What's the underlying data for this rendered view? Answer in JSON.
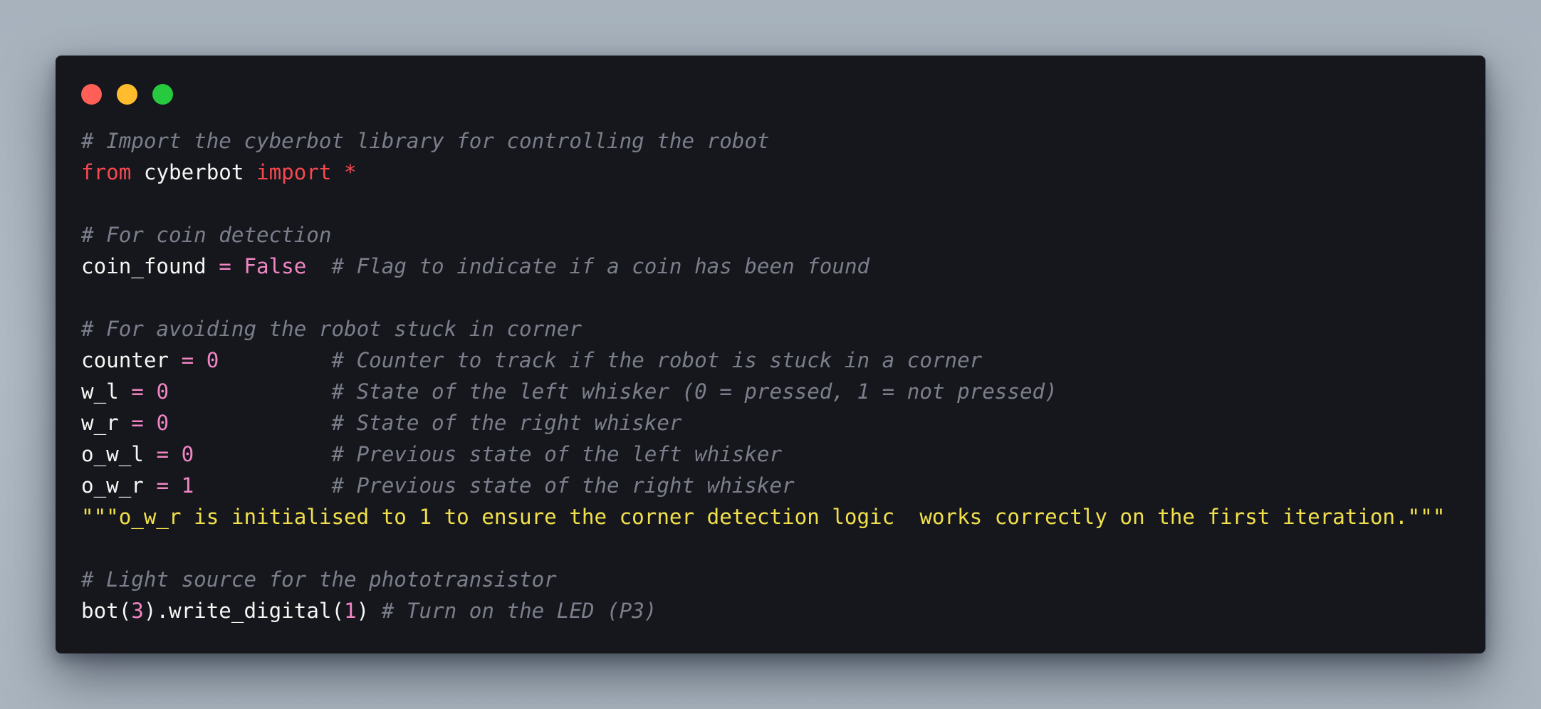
{
  "window": {
    "dots": [
      {
        "name": "close",
        "color": "#ff5f56"
      },
      {
        "name": "minimize",
        "color": "#ffbd2e"
      },
      {
        "name": "maximize",
        "color": "#27c93f"
      }
    ]
  },
  "colors": {
    "background": "#16171d",
    "comment": "#7b7f8b",
    "keyword": "#f5494f",
    "number_operator": "#f286c4",
    "string": "#f1e04b",
    "text": "#f6f6f4"
  },
  "code": {
    "l1": {
      "comment": "# Import the cyberbot library for controlling the robot"
    },
    "l2": {
      "kw1": "from",
      "ident": " cyberbot ",
      "kw2": "import",
      "star": " *"
    },
    "l4": {
      "comment": "# For coin detection"
    },
    "l5": {
      "ident": "coin_found",
      "op": " = ",
      "bool": "False",
      "comment": "  # Flag to indicate if a coin has been found"
    },
    "l7": {
      "comment": "# For avoiding the robot stuck in corner"
    },
    "l8": {
      "ident": "counter",
      "op": " = ",
      "num": "0",
      "pad": "         ",
      "comment": "# Counter to track if the robot is stuck in a corner"
    },
    "l9": {
      "ident": "w_l",
      "op": " = ",
      "num": "0",
      "pad": "             ",
      "comment": "# State of the left whisker (0 = pressed, 1 = not pressed)"
    },
    "l10": {
      "ident": "w_r",
      "op": " = ",
      "num": "0",
      "pad": "             ",
      "comment": "# State of the right whisker"
    },
    "l11": {
      "ident": "o_w_l",
      "op": " = ",
      "num": "0",
      "pad": "           ",
      "comment": "# Previous state of the left whisker"
    },
    "l12": {
      "ident": "o_w_r",
      "op": " = ",
      "num": "1",
      "pad": "           ",
      "comment": "# Previous state of the right whisker"
    },
    "l13": {
      "str": "\"\"\"o_w_r is initialised to 1 to ensure the corner detection logic  works correctly on the first iteration.\"\"\""
    },
    "l15": {
      "comment": "# Light source for the phototransistor"
    },
    "l16": {
      "p1": "bot(",
      "n1": "3",
      "p2": ").write_digital(",
      "n2": "1",
      "p3": ")",
      "comment": " # Turn on the LED (P3)"
    }
  }
}
